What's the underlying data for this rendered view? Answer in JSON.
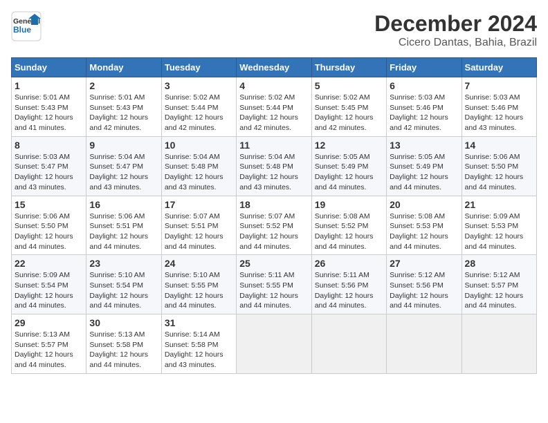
{
  "logo": {
    "line1": "General",
    "line2": "Blue"
  },
  "title": "December 2024",
  "subtitle": "Cicero Dantas, Bahia, Brazil",
  "days_of_week": [
    "Sunday",
    "Monday",
    "Tuesday",
    "Wednesday",
    "Thursday",
    "Friday",
    "Saturday"
  ],
  "weeks": [
    [
      {
        "day": "1",
        "info": "Sunrise: 5:01 AM\nSunset: 5:43 PM\nDaylight: 12 hours\nand 41 minutes."
      },
      {
        "day": "2",
        "info": "Sunrise: 5:01 AM\nSunset: 5:43 PM\nDaylight: 12 hours\nand 42 minutes."
      },
      {
        "day": "3",
        "info": "Sunrise: 5:02 AM\nSunset: 5:44 PM\nDaylight: 12 hours\nand 42 minutes."
      },
      {
        "day": "4",
        "info": "Sunrise: 5:02 AM\nSunset: 5:44 PM\nDaylight: 12 hours\nand 42 minutes."
      },
      {
        "day": "5",
        "info": "Sunrise: 5:02 AM\nSunset: 5:45 PM\nDaylight: 12 hours\nand 42 minutes."
      },
      {
        "day": "6",
        "info": "Sunrise: 5:03 AM\nSunset: 5:46 PM\nDaylight: 12 hours\nand 42 minutes."
      },
      {
        "day": "7",
        "info": "Sunrise: 5:03 AM\nSunset: 5:46 PM\nDaylight: 12 hours\nand 43 minutes."
      }
    ],
    [
      {
        "day": "8",
        "info": "Sunrise: 5:03 AM\nSunset: 5:47 PM\nDaylight: 12 hours\nand 43 minutes."
      },
      {
        "day": "9",
        "info": "Sunrise: 5:04 AM\nSunset: 5:47 PM\nDaylight: 12 hours\nand 43 minutes."
      },
      {
        "day": "10",
        "info": "Sunrise: 5:04 AM\nSunset: 5:48 PM\nDaylight: 12 hours\nand 43 minutes."
      },
      {
        "day": "11",
        "info": "Sunrise: 5:04 AM\nSunset: 5:48 PM\nDaylight: 12 hours\nand 43 minutes."
      },
      {
        "day": "12",
        "info": "Sunrise: 5:05 AM\nSunset: 5:49 PM\nDaylight: 12 hours\nand 44 minutes."
      },
      {
        "day": "13",
        "info": "Sunrise: 5:05 AM\nSunset: 5:49 PM\nDaylight: 12 hours\nand 44 minutes."
      },
      {
        "day": "14",
        "info": "Sunrise: 5:06 AM\nSunset: 5:50 PM\nDaylight: 12 hours\nand 44 minutes."
      }
    ],
    [
      {
        "day": "15",
        "info": "Sunrise: 5:06 AM\nSunset: 5:50 PM\nDaylight: 12 hours\nand 44 minutes."
      },
      {
        "day": "16",
        "info": "Sunrise: 5:06 AM\nSunset: 5:51 PM\nDaylight: 12 hours\nand 44 minutes."
      },
      {
        "day": "17",
        "info": "Sunrise: 5:07 AM\nSunset: 5:51 PM\nDaylight: 12 hours\nand 44 minutes."
      },
      {
        "day": "18",
        "info": "Sunrise: 5:07 AM\nSunset: 5:52 PM\nDaylight: 12 hours\nand 44 minutes."
      },
      {
        "day": "19",
        "info": "Sunrise: 5:08 AM\nSunset: 5:52 PM\nDaylight: 12 hours\nand 44 minutes."
      },
      {
        "day": "20",
        "info": "Sunrise: 5:08 AM\nSunset: 5:53 PM\nDaylight: 12 hours\nand 44 minutes."
      },
      {
        "day": "21",
        "info": "Sunrise: 5:09 AM\nSunset: 5:53 PM\nDaylight: 12 hours\nand 44 minutes."
      }
    ],
    [
      {
        "day": "22",
        "info": "Sunrise: 5:09 AM\nSunset: 5:54 PM\nDaylight: 12 hours\nand 44 minutes."
      },
      {
        "day": "23",
        "info": "Sunrise: 5:10 AM\nSunset: 5:54 PM\nDaylight: 12 hours\nand 44 minutes."
      },
      {
        "day": "24",
        "info": "Sunrise: 5:10 AM\nSunset: 5:55 PM\nDaylight: 12 hours\nand 44 minutes."
      },
      {
        "day": "25",
        "info": "Sunrise: 5:11 AM\nSunset: 5:55 PM\nDaylight: 12 hours\nand 44 minutes."
      },
      {
        "day": "26",
        "info": "Sunrise: 5:11 AM\nSunset: 5:56 PM\nDaylight: 12 hours\nand 44 minutes."
      },
      {
        "day": "27",
        "info": "Sunrise: 5:12 AM\nSunset: 5:56 PM\nDaylight: 12 hours\nand 44 minutes."
      },
      {
        "day": "28",
        "info": "Sunrise: 5:12 AM\nSunset: 5:57 PM\nDaylight: 12 hours\nand 44 minutes."
      }
    ],
    [
      {
        "day": "29",
        "info": "Sunrise: 5:13 AM\nSunset: 5:57 PM\nDaylight: 12 hours\nand 44 minutes."
      },
      {
        "day": "30",
        "info": "Sunrise: 5:13 AM\nSunset: 5:58 PM\nDaylight: 12 hours\nand 44 minutes."
      },
      {
        "day": "31",
        "info": "Sunrise: 5:14 AM\nSunset: 5:58 PM\nDaylight: 12 hours\nand 43 minutes."
      },
      {
        "day": "",
        "info": ""
      },
      {
        "day": "",
        "info": ""
      },
      {
        "day": "",
        "info": ""
      },
      {
        "day": "",
        "info": ""
      }
    ]
  ]
}
